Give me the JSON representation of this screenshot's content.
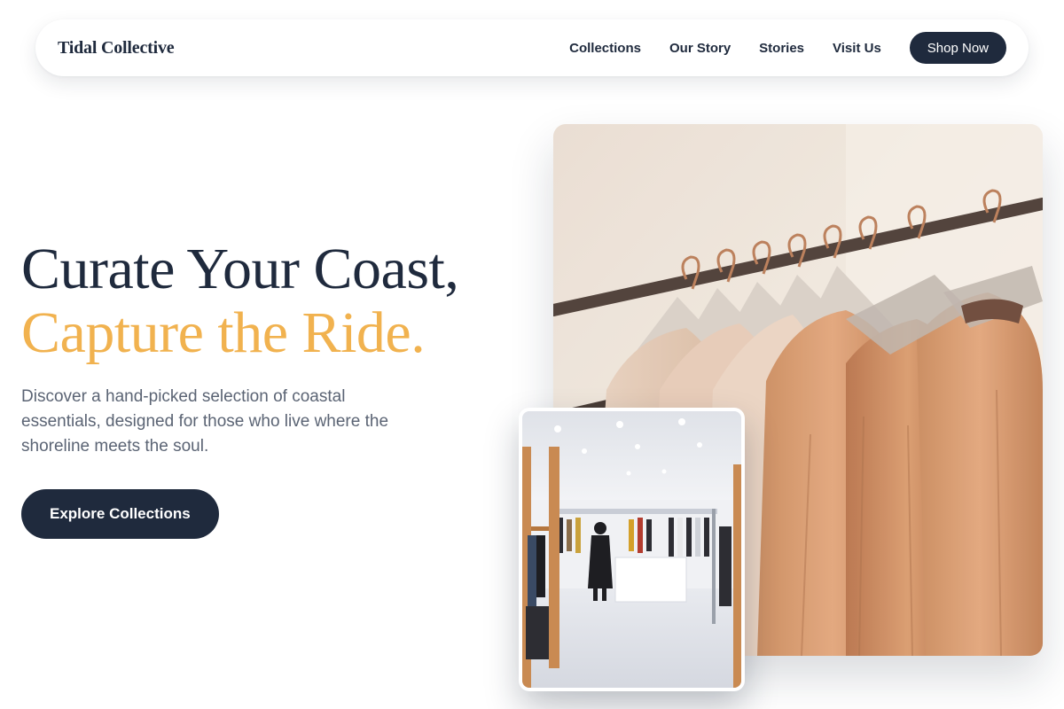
{
  "nav": {
    "brand": "Tidal Collective",
    "links": [
      {
        "label": "Collections"
      },
      {
        "label": "Our Story"
      },
      {
        "label": "Stories"
      },
      {
        "label": "Visit Us"
      }
    ],
    "cta": "Shop Now"
  },
  "hero": {
    "headline_line1": "Curate Your Coast,",
    "headline_line2": "Capture the Ride.",
    "subcopy": "Discover a hand-picked selection of coastal essentials, designed for those who live where the shoreline meets the soul.",
    "button": "Explore Collections"
  },
  "colors": {
    "navy": "#1f2a3d",
    "accent": "#f1b24f",
    "body_text": "#5b6474"
  },
  "images": {
    "main": "clothing-rack-photo",
    "inset": "store-interior-photo"
  }
}
